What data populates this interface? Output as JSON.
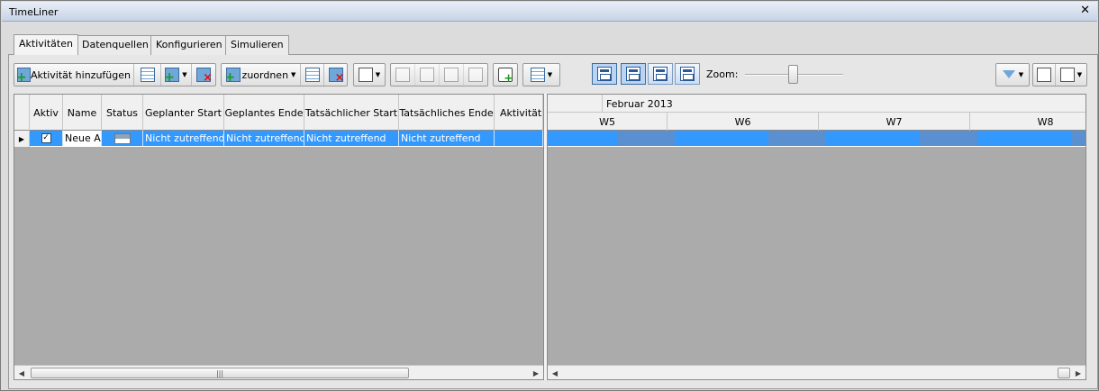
{
  "window": {
    "title": "TimeLiner"
  },
  "tabs": [
    "Aktivitäten",
    "Datenquellen",
    "Konfigurieren",
    "Simulieren"
  ],
  "toolbar": {
    "add_activity_label": "Aktivität hinzufügen",
    "assign_label": "zuordnen",
    "zoom_label": "Zoom:"
  },
  "grid": {
    "columns": [
      "Aktiv",
      "Name",
      "Status",
      "Geplanter Start",
      "Geplantes Ende",
      "Tatsächlicher Start",
      "Tatsächliches Ende",
      "Aktivitätst"
    ],
    "rows": [
      {
        "active": true,
        "name": "Neue Ak",
        "planned_start": "Nicht zutreffend",
        "planned_end": "Nicht zutreffend",
        "actual_start": "Nicht zutreffend",
        "actual_end": "Nicht zutreffend",
        "activity_type": ""
      }
    ]
  },
  "gantt": {
    "month": "Februar 2013",
    "weeks": [
      "W5",
      "W6",
      "W7",
      "W8"
    ]
  },
  "colors": {
    "selection": "#3399ff",
    "nonworking": "#5a8fd0",
    "empty_area": "#ababab"
  }
}
